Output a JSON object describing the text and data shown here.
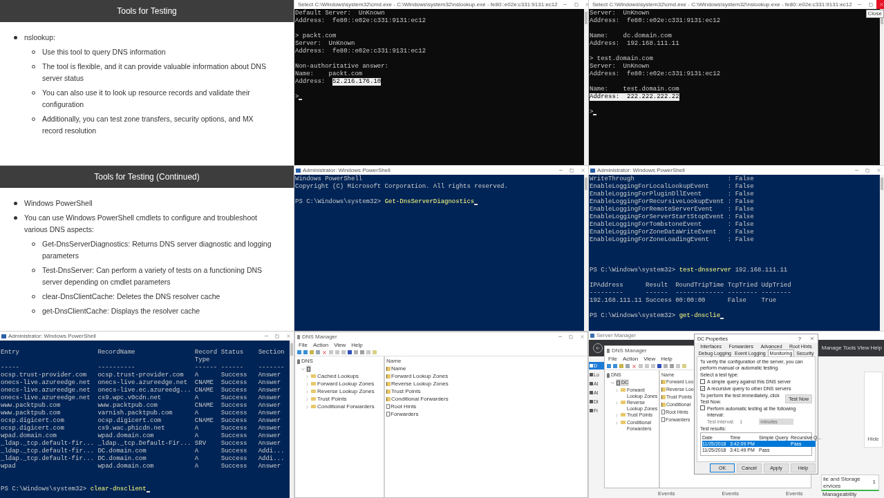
{
  "panels": [
    {
      "kind": "slide",
      "title": "Tools for Testing",
      "bullets": [
        {
          "text": "nslookup:",
          "children": [
            {
              "text": "Use this tool to query DNS information"
            },
            {
              "text": "The tool is flexible, and it can provide valuable information about DNS server status"
            },
            {
              "text": "You can also use it to look up resource records and validate their configuration"
            },
            {
              "text": "Additionally, you can test zone transfers, security options, and MX record resolution"
            }
          ]
        }
      ]
    },
    {
      "kind": "cmd_console",
      "title": "Select C:\\Windows\\system32\\cmd.exe - C:\\Windows\\system32\\nslookup.exe - fe80::e02e:c331:9131:ec12",
      "close_hovered": false,
      "lines": [
        {
          "kind": "text",
          "text": "Default Server:  UnKnown"
        },
        {
          "kind": "text",
          "text": "Address:  fe80::e02e:c331:9131:ec12"
        },
        {
          "kind": "blank"
        },
        {
          "kind": "text",
          "text": "> packt.com"
        },
        {
          "kind": "text",
          "text": "Server:  UnKnown"
        },
        {
          "kind": "text",
          "text": "Address:  fe80::e02e:c331:9131:ec12"
        },
        {
          "kind": "blank"
        },
        {
          "kind": "text",
          "text": "Non-authoritative answer:"
        },
        {
          "kind": "text",
          "text": "Name:    packt.com"
        },
        {
          "kind": "mixed",
          "parts": [
            {
              "kind": "plain",
              "text": "Address:  "
            },
            {
              "kind": "selected",
              "text": "52.216.176.10"
            }
          ]
        },
        {
          "kind": "blank"
        },
        {
          "kind": "mixed",
          "parts": [
            {
              "kind": "plain",
              "text": ">"
            },
            {
              "kind": "cursor"
            }
          ]
        }
      ]
    },
    {
      "kind": "cmd_console",
      "title": "Select C:\\Windows\\system32\\cmd.exe - C:\\Windows\\system32\\nslookup.exe - fe80::e02e:c331:9131:ec12",
      "close_hovered": true,
      "tooltip": "Close",
      "lines": [
        {
          "kind": "text",
          "text": "Server:  UnKnown"
        },
        {
          "kind": "text",
          "text": "Address:  fe80::e02e:c331:9131:ec12"
        },
        {
          "kind": "blank"
        },
        {
          "kind": "text",
          "text": "Name:    dc.domain.com"
        },
        {
          "kind": "text",
          "text": "Address:  192.168.111.11"
        },
        {
          "kind": "blank"
        },
        {
          "kind": "text",
          "text": "> test.domain.com"
        },
        {
          "kind": "text",
          "text": "Server:  UnKnown"
        },
        {
          "kind": "text",
          "text": "Address:  fe80::e02e:c331:9131:ec12"
        },
        {
          "kind": "blank"
        },
        {
          "kind": "text",
          "text": "Name:    test.domain.com"
        },
        {
          "kind": "mixed",
          "parts": [
            {
              "kind": "selected",
              "text": "Address:  222.222.222.22"
            }
          ]
        },
        {
          "kind": "blank"
        },
        {
          "kind": "mixed",
          "parts": [
            {
              "kind": "plain",
              "text": ">"
            },
            {
              "kind": "cursor"
            }
          ]
        }
      ]
    },
    {
      "kind": "slide",
      "title": "Tools for Testing (Continued)",
      "bullets": [
        {
          "text": "Windows PowerShell"
        },
        {
          "text": "You can use Windows PowerShell cmdlets to configure and troubleshoot various DNS aspects:",
          "children": [
            {
              "text": "Get-DnsServerDiagnostics: Returns DNS server diagnostic and logging parameters"
            },
            {
              "text": "Test-DnsServer: Can perform a variety of tests on a functioning DNS server depending on cmdlet parameters"
            },
            {
              "text": "clear-DnsClientCache: Deletes the DNS resolver cache"
            },
            {
              "text": "get-DnsClientCache: Displays the resolver cache"
            }
          ]
        }
      ]
    },
    {
      "kind": "powershell_console",
      "title": "Administrator: Windows PowerShell",
      "close_hovered": false,
      "lines": [
        {
          "kind": "text",
          "text": "Windows PowerShell"
        },
        {
          "kind": "text",
          "text": "Copyright (C) Microsoft Corporation. All rights reserved."
        },
        {
          "kind": "blank"
        },
        {
          "kind": "mixed",
          "parts": [
            {
              "kind": "plain",
              "text": "PS C:\\Windows\\system32> "
            },
            {
              "kind": "command",
              "text": "Get-DnsServerDiagnostics"
            },
            {
              "kind": "cursor"
            }
          ]
        }
      ]
    },
    {
      "kind": "powershell_console",
      "title": "Administrator: Windows PowerShell",
      "close_hovered": false,
      "lines": [
        {
          "kind": "text",
          "text": "WriteThrough                         : False"
        },
        {
          "kind": "text",
          "text": "EnableLoggingForLocalLookupEvent     : False"
        },
        {
          "kind": "text",
          "text": "EnableLoggingForPluginDllEvent       : False"
        },
        {
          "kind": "text",
          "text": "EnableLoggingForRecursiveLookupEvent : False"
        },
        {
          "kind": "text",
          "text": "EnableLoggingForRemoteServerEvent    : False"
        },
        {
          "kind": "text",
          "text": "EnableLoggingForServerStartStopEvent : False"
        },
        {
          "kind": "text",
          "text": "EnableLoggingForTombstoneEvent       : False"
        },
        {
          "kind": "text",
          "text": "EnableLoggingForZoneDataWriteEvent   : False"
        },
        {
          "kind": "text",
          "text": "EnableLoggingForZoneLoadingEvent     : False"
        },
        {
          "kind": "blank"
        },
        {
          "kind": "blank"
        },
        {
          "kind": "blank"
        },
        {
          "kind": "mixed",
          "parts": [
            {
              "kind": "plain",
              "text": "PS C:\\Windows\\system32> "
            },
            {
              "kind": "command",
              "text": "test-dnsserver"
            },
            {
              "kind": "plain",
              "text": " 192.168.111.11"
            }
          ]
        },
        {
          "kind": "blank"
        },
        {
          "kind": "text",
          "text": "IPAddress      Result  RoundTripTime TcpTried UdpTried"
        },
        {
          "kind": "text",
          "text": "---------      ------  ------------- -------- --------"
        },
        {
          "kind": "text",
          "text": "192.168.111.11 Success 00:00:00      False    True"
        },
        {
          "kind": "blank"
        },
        {
          "kind": "mixed",
          "parts": [
            {
              "kind": "plain",
              "text": "PS C:\\Windows\\system32> "
            },
            {
              "kind": "command",
              "text": "get-dnsclie"
            },
            {
              "kind": "cursor"
            }
          ]
        }
      ]
    },
    {
      "kind": "powershell_console",
      "title": "Administrator: Windows PowerShell",
      "close_hovered": false,
      "lines": [
        {
          "kind": "blank"
        },
        {
          "kind": "table",
          "columns": [
            "Entry",
            "RecordName",
            "Record Type",
            "Status",
            "Section"
          ],
          "rules": [
            "-----",
            "----------",
            "------",
            "------",
            "-------"
          ],
          "rows": [
            [
              "ocsp.trust-provider.com",
              "ocsp.trust-provider.com",
              "A",
              "Success",
              "Answer"
            ],
            [
              "onecs-live.azureedge.net",
              "onecs-live.azureedge.net",
              "CNAME",
              "Success",
              "Answer"
            ],
            [
              "onecs-live.azureedge.net",
              "onecs-live.ec.azureedg...",
              "CNAME",
              "Success",
              "Answer"
            ],
            [
              "onecs-live.azureedge.net",
              "cs9.wpc.v0cdn.net",
              "A",
              "Success",
              "Answer"
            ],
            [
              "www.packtpub.com",
              "www.packtpub.com",
              "CNAME",
              "Success",
              "Answer"
            ],
            [
              "www.packtpub.com",
              "varnish.packtpub.com",
              "A",
              "Success",
              "Answer"
            ],
            [
              "ocsp.digicert.com",
              "ocsp.digicert.com",
              "CNAME",
              "Success",
              "Answer"
            ],
            [
              "ocsp.digicert.com",
              "cs9.wac.phicdn.net",
              "A",
              "Success",
              "Answer"
            ],
            [
              "wpad.domain.com",
              "wpad.domain.com",
              "A",
              "Success",
              "Answer"
            ],
            [
              "_ldap._tcp.default-fir...",
              "_ldap._tcp.Default-Fir...",
              "SRV",
              "Success",
              "Answer"
            ],
            [
              "_ldap._tcp.default-fir...",
              "DC.domain.com",
              "A",
              "Success",
              "Addi..."
            ],
            [
              "_ldap._tcp.default-fir...",
              "DC.domain.com",
              "A",
              "Success",
              "Addi..."
            ],
            [
              "wpad",
              "wpad.domain.com",
              "A",
              "Success",
              "Answer"
            ]
          ]
        },
        {
          "kind": "blank"
        },
        {
          "kind": "blank"
        },
        {
          "kind": "mixed",
          "parts": [
            {
              "kind": "plain",
              "text": "PS C:\\Windows\\system32> "
            },
            {
              "kind": "command",
              "text": "clear-dnsclient"
            },
            {
              "kind": "cursor"
            }
          ]
        }
      ]
    },
    {
      "kind": "dns_manager",
      "window": {
        "title": "DNS Manager",
        "menu": [
          "File",
          "Action",
          "View",
          "Help"
        ],
        "tree": [
          {
            "kind": "root",
            "text": "DNS",
            "selected": false,
            "children": [
              {
                "kind": "server",
                "expanded": true,
                "selected": true,
                "children": [
                  {
                    "kind": "folder",
                    "text": "Cached Lookups",
                    "expanded": false,
                    "selected": false
                  },
                  {
                    "kind": "folder",
                    "text": "Forward Lookup Zones",
                    "expanded": false,
                    "selected": false
                  },
                  {
                    "kind": "folder",
                    "text": "Reverse Lookup Zones",
                    "expanded": false,
                    "selected": false
                  },
                  {
                    "kind": "folder",
                    "text": "Trust Points",
                    "expanded": false,
                    "selected": false
                  },
                  {
                    "kind": "folder",
                    "text": "Conditional Forwarders",
                    "expanded": false,
                    "selected": false
                  }
                ]
              }
            ]
          }
        ],
        "list_header": "Name",
        "list": [
          {
            "kind": "folder",
            "text": "Name"
          },
          {
            "kind": "folder",
            "text": "Forward Lookup Zones"
          },
          {
            "kind": "folder",
            "text": "Reverse Lookup Zones"
          },
          {
            "kind": "folder",
            "text": "Trust Points"
          },
          {
            "kind": "folder",
            "text": "Conditional Forwarders"
          },
          {
            "kind": "doc",
            "text": "Root Hints"
          },
          {
            "kind": "doc",
            "text": "Forwarders"
          }
        ]
      }
    },
    {
      "kind": "server_manager",
      "title": "Server Manager",
      "menu": [
        "Manage",
        "Tools",
        "View",
        "Help"
      ],
      "sidebar": [
        {
          "text": "D",
          "selected": true
        },
        {
          "text": "Lo",
          "selected": false
        },
        {
          "text": "Al",
          "selected": false
        },
        {
          "text": "Al",
          "selected": false
        },
        {
          "text": "Di",
          "selected": false
        },
        {
          "text": "Fi",
          "selected": false
        }
      ],
      "hide_link": "Hide",
      "tile": {
        "title_lines": [
          "ile and Storage",
          "ervices"
        ],
        "count": "1",
        "items": [
          "Manageability"
        ]
      },
      "events": [
        "Events",
        "Events",
        "Events"
      ],
      "window": {
        "title": "DNS Manager",
        "menu": [
          "File",
          "Action",
          "View",
          "Help"
        ],
        "tree": [
          {
            "kind": "root",
            "text": "DNS",
            "selected": false,
            "children": [
              {
                "kind": "server",
                "text": "DC",
                "expanded": true,
                "selected": true,
                "children": [
                  {
                    "kind": "folder",
                    "text": "Forward Lookup Zones",
                    "expanded": false,
                    "selected": false
                  },
                  {
                    "kind": "folder",
                    "text": "Reverse Lookup Zones",
                    "expanded": false,
                    "selected": false
                  },
                  {
                    "kind": "folder",
                    "text": "Trust Points",
                    "expanded": false,
                    "selected": false
                  },
                  {
                    "kind": "folder",
                    "text": "Conditional Forwarders",
                    "expanded": false,
                    "selected": false
                  }
                ]
              }
            ]
          }
        ],
        "list_header": "Name",
        "list": [
          {
            "kind": "folder",
            "text": "Forward Loo"
          },
          {
            "kind": "folder",
            "text": "Reverse Loo"
          },
          {
            "kind": "folder",
            "text": "Trust Points"
          },
          {
            "kind": "folder",
            "text": "Conditional"
          },
          {
            "kind": "doc",
            "text": "Root Hints"
          },
          {
            "kind": "doc",
            "text": "Forwarders"
          }
        ]
      },
      "dialog": {
        "title": "DC Properties",
        "help_button": "?",
        "tab_rows": [
          [
            {
              "label": "Interfaces",
              "selected": false
            },
            {
              "label": "Forwarders",
              "selected": false
            },
            {
              "label": "Advanced",
              "selected": false
            },
            {
              "label": "Root Hints",
              "selected": false
            }
          ],
          [
            {
              "label": "Debug Logging",
              "selected": false
            },
            {
              "label": "Event Logging",
              "selected": false
            },
            {
              "label": "Monitoring",
              "selected": true
            },
            {
              "label": "Security",
              "selected": false
            }
          ]
        ],
        "intro": "To verify the configuration of the server, you can perform manual or automatic testing.",
        "test_type_label": "Select a test type:",
        "options": [
          {
            "label": "A simple query against this DNS server",
            "checked": false
          },
          {
            "label": "A recursive query to other DNS servers",
            "checked": true
          }
        ],
        "test_now_text": "To perform the test immediately, click Test Now.",
        "test_now_button": "Test Now",
        "auto": {
          "label": "Perform automatic testing at the following interval:",
          "checked": false
        },
        "interval": {
          "label": "Test interval:",
          "value": "1",
          "unit": "minutes",
          "disabled": true
        },
        "results": {
          "label": "Test results:",
          "columns": [
            "Date",
            "Time",
            "Simple Query",
            "Recursive Q..."
          ],
          "rows": [
            {
              "cells": [
                "11/25/2018",
                "3:42:09 PM",
                null,
                "Pass"
              ],
              "selected": true
            },
            {
              "cells": [
                "11/25/2018",
                "3:41:49 PM",
                "Pass",
                null
              ],
              "selected": false
            }
          ]
        },
        "buttons": [
          "OK",
          "Cancel",
          "Apply",
          "Help"
        ]
      }
    }
  ]
}
